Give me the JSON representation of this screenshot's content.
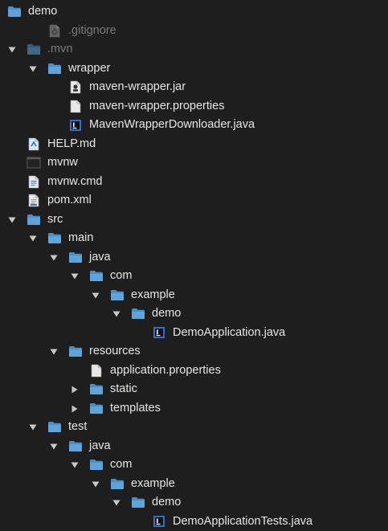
{
  "tree": [
    {
      "label": "demo",
      "type": "folder",
      "depth": 0,
      "expanded": null,
      "dim": false
    },
    {
      "label": ".gitignore",
      "type": "file-gitignore",
      "depth": 1,
      "expanded": null,
      "dim": true
    },
    {
      "label": ".mvn",
      "type": "folder",
      "depth": 0,
      "expanded": true,
      "dim": true
    },
    {
      "label": "wrapper",
      "type": "folder",
      "depth": 1,
      "expanded": true,
      "dim": false
    },
    {
      "label": "maven-wrapper.jar",
      "type": "file-jar",
      "depth": 2,
      "expanded": null,
      "dim": false
    },
    {
      "label": "maven-wrapper.properties",
      "type": "file-text",
      "depth": 2,
      "expanded": null,
      "dim": false
    },
    {
      "label": "MavenWrapperDownloader.java",
      "type": "file-java",
      "depth": 2,
      "expanded": null,
      "dim": false
    },
    {
      "label": "HELP.md",
      "type": "file-md",
      "depth": 0,
      "expanded": null,
      "dim": false
    },
    {
      "label": "mvnw",
      "type": "file-exec",
      "depth": 0,
      "expanded": null,
      "dim": false
    },
    {
      "label": "mvnw.cmd",
      "type": "file-cmd",
      "depth": 0,
      "expanded": null,
      "dim": false
    },
    {
      "label": "pom.xml",
      "type": "file-xml",
      "depth": 0,
      "expanded": null,
      "dim": false
    },
    {
      "label": "src",
      "type": "folder",
      "depth": 0,
      "expanded": true,
      "dim": false
    },
    {
      "label": "main",
      "type": "folder",
      "depth": 1,
      "expanded": true,
      "dim": false
    },
    {
      "label": "java",
      "type": "folder",
      "depth": 2,
      "expanded": true,
      "dim": false
    },
    {
      "label": "com",
      "type": "folder",
      "depth": 3,
      "expanded": true,
      "dim": false
    },
    {
      "label": "example",
      "type": "folder",
      "depth": 4,
      "expanded": true,
      "dim": false
    },
    {
      "label": "demo",
      "type": "folder",
      "depth": 5,
      "expanded": true,
      "dim": false
    },
    {
      "label": "DemoApplication.java",
      "type": "file-java",
      "depth": 6,
      "expanded": null,
      "dim": false
    },
    {
      "label": "resources",
      "type": "folder",
      "depth": 2,
      "expanded": true,
      "dim": false
    },
    {
      "label": "application.properties",
      "type": "file-text",
      "depth": 3,
      "expanded": null,
      "dim": false
    },
    {
      "label": "static",
      "type": "folder",
      "depth": 3,
      "expanded": false,
      "dim": false
    },
    {
      "label": "templates",
      "type": "folder",
      "depth": 3,
      "expanded": false,
      "dim": false
    },
    {
      "label": "test",
      "type": "folder",
      "depth": 1,
      "expanded": true,
      "dim": false
    },
    {
      "label": "java",
      "type": "folder",
      "depth": 2,
      "expanded": true,
      "dim": false
    },
    {
      "label": "com",
      "type": "folder",
      "depth": 3,
      "expanded": true,
      "dim": false
    },
    {
      "label": "example",
      "type": "folder",
      "depth": 4,
      "expanded": true,
      "dim": false
    },
    {
      "label": "demo",
      "type": "folder",
      "depth": 5,
      "expanded": true,
      "dim": false
    },
    {
      "label": "DemoApplicationTests.java",
      "type": "file-java",
      "depth": 6,
      "expanded": null,
      "dim": false
    }
  ],
  "colors": {
    "background": "#1e1e1e",
    "folder": "#5fa3d8",
    "folder_tab": "#4a8fc6",
    "text": "#e6e6e6",
    "dim_text": "#7a7a7a",
    "java_icon": "#2f6fd1",
    "arrow": "#c8c8c8"
  }
}
